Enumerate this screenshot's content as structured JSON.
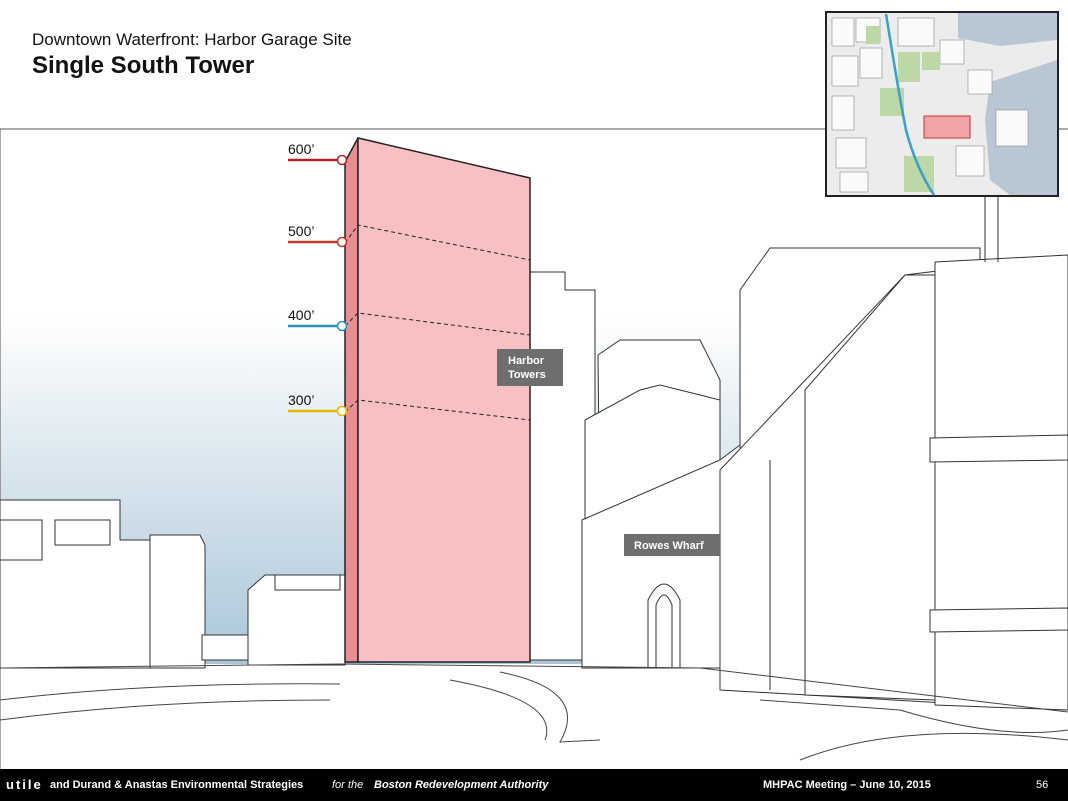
{
  "header": {
    "subtitle": "Downtown Waterfront: Harbor Garage Site",
    "title": "Single South Tower"
  },
  "height_markers": [
    {
      "label": "600’",
      "color": "#b22222"
    },
    {
      "label": "500’",
      "color": "#c0392b"
    },
    {
      "label": "400’",
      "color": "#2b8fb8"
    },
    {
      "label": "300’",
      "color": "#e6b800"
    }
  ],
  "callouts": {
    "harbor_towers_line1": "Harbor",
    "harbor_towers_line2": "Towers",
    "rowes_wharf": "Rowes Wharf"
  },
  "colors": {
    "tower_fill": "#f7c1c4",
    "sky_top": "#ffffff",
    "sky_bottom": "#b7cfdf",
    "callout_bg": "#6e6e6e",
    "footer_bg": "#000000"
  },
  "footer": {
    "logo": "utile",
    "orgs": "and Durand & Anastas Environmental Strategies",
    "for_text": "for the",
    "client": "Boston Redevelopment Authority",
    "meeting": "MHPAC Meeting  – June 10, 2015",
    "page": "56"
  }
}
